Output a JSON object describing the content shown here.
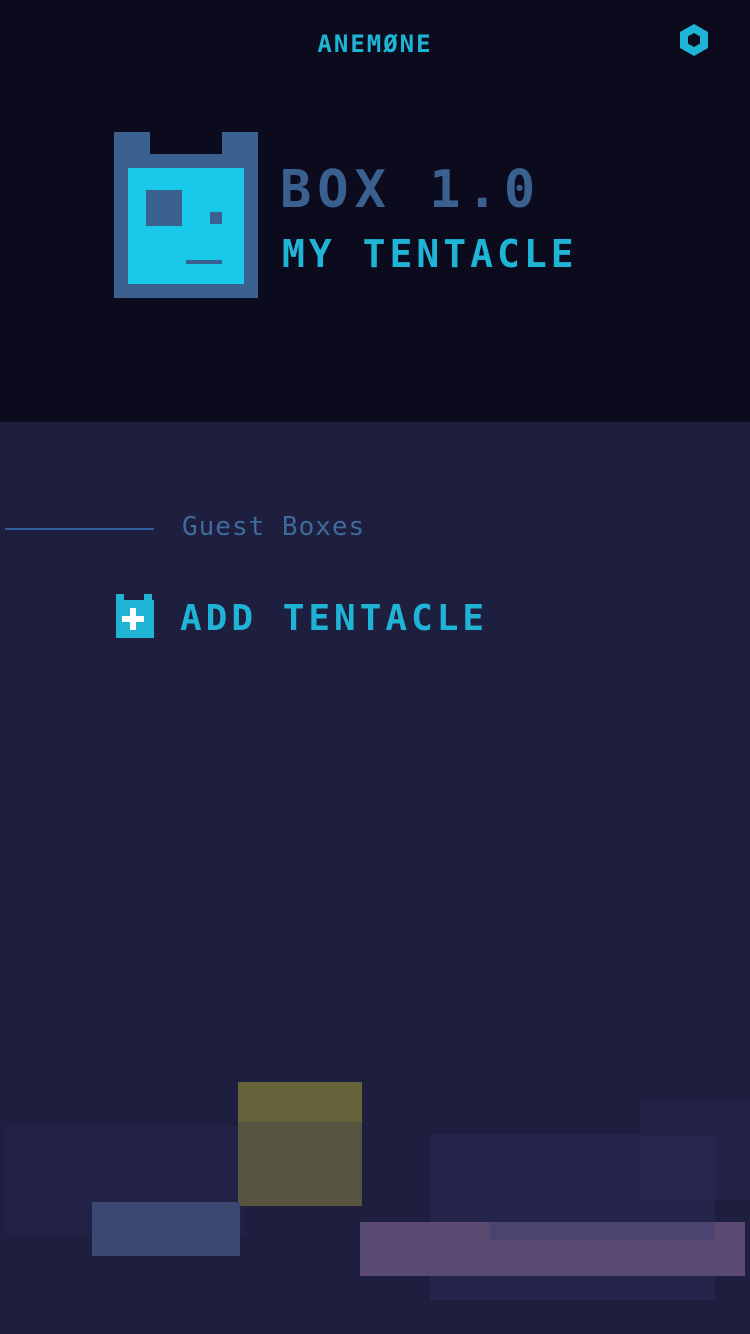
{
  "header": {
    "app_title": "ANEMØNE",
    "settings_icon": "hexagon-gear-icon"
  },
  "profile": {
    "avatar_icon": "pixel-box-face-icon",
    "box_version": "BOX 1.0",
    "tentacle_name": "MY TENTACLE"
  },
  "guest_section": {
    "label": "Guest Boxes",
    "add_button_label": "ADD TENTACLE",
    "add_icon": "plus-box-icon"
  },
  "colors": {
    "accent": "#1fb4d6",
    "muted_blue": "#3a608f",
    "top_bg": "#0b0b1d",
    "bottom_bg": "#1e1e3f"
  }
}
